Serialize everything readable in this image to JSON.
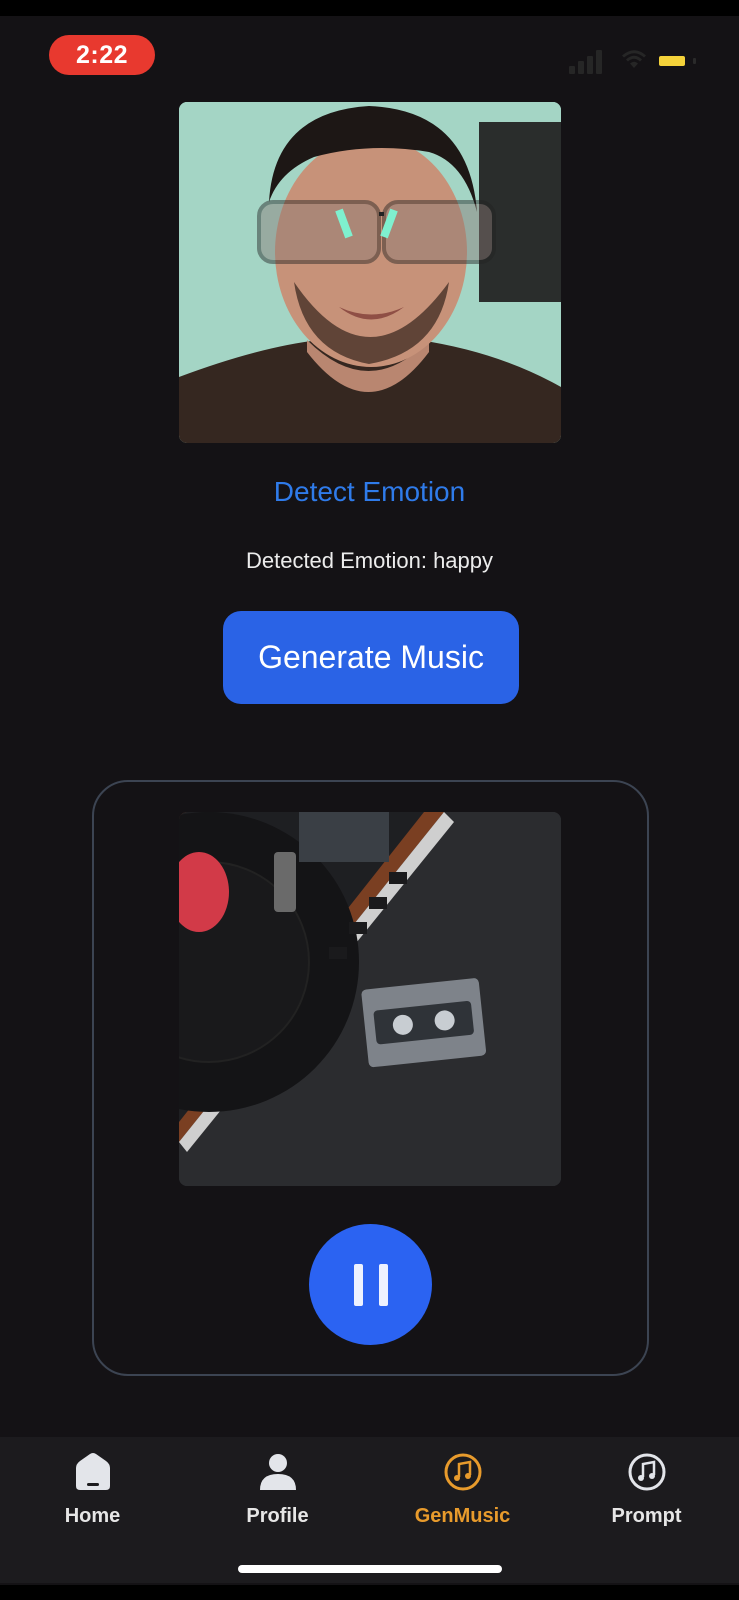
{
  "status_bar": {
    "time": "2:22",
    "time_pill_color": "#e8392f",
    "battery_color": "#f4d23a"
  },
  "camera": {
    "image": "user-face-photo"
  },
  "detect_button": {
    "label": "Detect Emotion",
    "color": "#2f7bea"
  },
  "detected_text": "Detected Emotion: happy",
  "generate_button": {
    "label": "Generate Music",
    "color": "#2a63e6"
  },
  "player": {
    "artwork": "turntable-cassette-artwork",
    "state": "playing",
    "control_icon": "pause-icon",
    "control_color": "#2b63f2"
  },
  "tabs": [
    {
      "label": "Home",
      "icon": "home-icon",
      "active": false
    },
    {
      "label": "Profile",
      "icon": "person-icon",
      "active": false
    },
    {
      "label": "GenMusic",
      "icon": "music-note-icon",
      "active": true
    },
    {
      "label": "Prompt",
      "icon": "music-note-icon",
      "active": false
    }
  ],
  "active_tab_color": "#e89b2c"
}
